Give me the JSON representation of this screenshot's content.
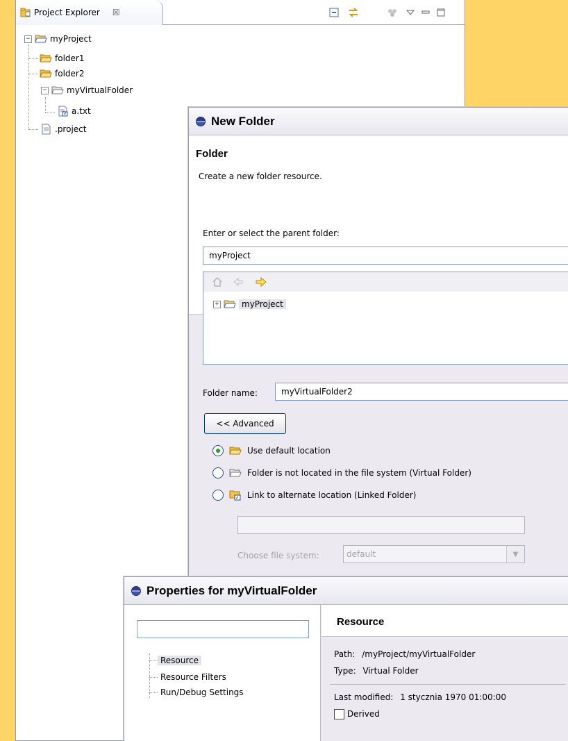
{
  "explorer": {
    "tab_label": "Project Explorer",
    "tab_close": "☒",
    "tree": [
      {
        "label": "myProject",
        "icon": "folder-open-icon",
        "expander": "−"
      },
      {
        "label": "folder1",
        "icon": "folder-icon"
      },
      {
        "label": "folder2",
        "icon": "folder-icon"
      },
      {
        "label": "myVirtualFolder",
        "icon": "virtual-folder-icon",
        "expander": "−"
      },
      {
        "label": "a.txt",
        "icon": "linked-file-icon"
      },
      {
        "label": ".project",
        "icon": "file-icon"
      }
    ]
  },
  "new_folder": {
    "title": "New Folder",
    "header_title": "Folder",
    "header_desc": "Create a new folder resource.",
    "parent_label": "Enter or select the parent folder:",
    "parent_value": "myProject",
    "tree_item": "myProject",
    "folder_name_label": "Folder name:",
    "folder_name_value": "myVirtualFolder2",
    "advanced_button": "<< Advanced",
    "options": [
      {
        "label": "Use default location",
        "checked": true
      },
      {
        "label": "Folder is not located in the file system (Virtual Folder)",
        "checked": false
      },
      {
        "label": "Link to alternate location (Linked Folder)",
        "checked": false
      }
    ],
    "choose_fs_label": "Choose file system:",
    "choose_fs_value": "default"
  },
  "properties": {
    "title": "Properties for myVirtualFolder",
    "filter_placeholder": "",
    "nav": [
      "Resource",
      "Resource Filters",
      "Run/Debug Settings"
    ],
    "section_title": "Resource",
    "path_label": "Path:",
    "path_value": "/myProject/myVirtualFolder",
    "type_label": "Type:",
    "type_value": "Virtual Folder",
    "modified_label": "Last modified:",
    "modified_value": "1 stycznia 1970 01:00:00",
    "derived_label": "Derived"
  },
  "colors": {
    "background": "#ffd466",
    "folder": "#f5c542",
    "radio_dot": "#21a121"
  }
}
